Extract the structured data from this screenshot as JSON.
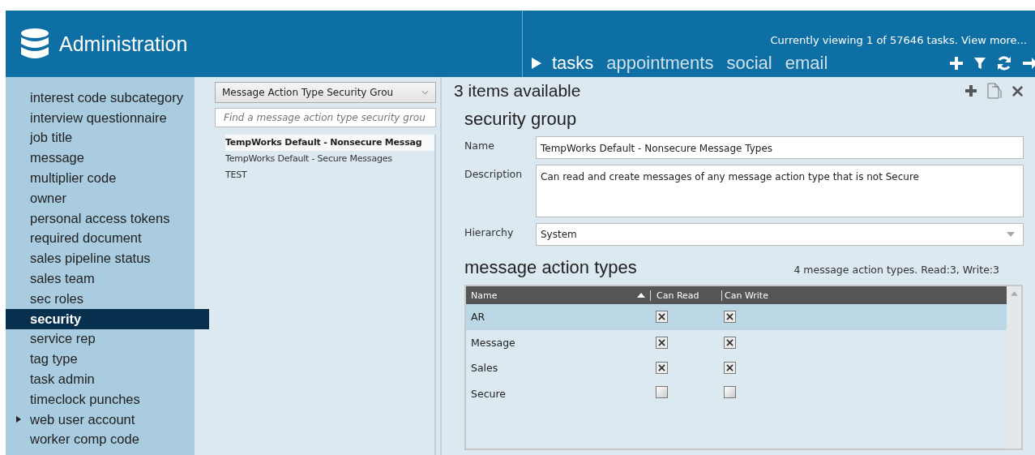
{
  "header": {
    "title": "Administration",
    "status": "Currently viewing 1 of 57646 tasks. View more...",
    "tabs": [
      {
        "label": "tasks",
        "selected": true
      },
      {
        "label": "appointments",
        "selected": false
      },
      {
        "label": "social",
        "selected": false
      },
      {
        "label": "email",
        "selected": false
      }
    ]
  },
  "sidebar": {
    "items": [
      {
        "label": "interest code subcategory",
        "selected": false,
        "has_children": false
      },
      {
        "label": "interview questionnaire",
        "selected": false,
        "has_children": false
      },
      {
        "label": "job title",
        "selected": false,
        "has_children": false
      },
      {
        "label": "message",
        "selected": false,
        "has_children": false
      },
      {
        "label": "multiplier code",
        "selected": false,
        "has_children": false
      },
      {
        "label": "owner",
        "selected": false,
        "has_children": false
      },
      {
        "label": "personal access tokens",
        "selected": false,
        "has_children": false
      },
      {
        "label": "required document",
        "selected": false,
        "has_children": false
      },
      {
        "label": "sales pipeline status",
        "selected": false,
        "has_children": false
      },
      {
        "label": "sales team",
        "selected": false,
        "has_children": false
      },
      {
        "label": "sec roles",
        "selected": false,
        "has_children": false
      },
      {
        "label": "security",
        "selected": true,
        "has_children": false
      },
      {
        "label": "service rep",
        "selected": false,
        "has_children": false
      },
      {
        "label": "tag type",
        "selected": false,
        "has_children": false
      },
      {
        "label": "task admin",
        "selected": false,
        "has_children": false
      },
      {
        "label": "timeclock punches",
        "selected": false,
        "has_children": false
      },
      {
        "label": "web user account",
        "selected": false,
        "has_children": true
      },
      {
        "label": "worker comp code",
        "selected": false,
        "has_children": false
      }
    ]
  },
  "list_panel": {
    "type_select": "Message Action Type Security Grou",
    "search": {
      "placeholder": "Find a message action type security grou"
    },
    "items": [
      {
        "label": "TempWorks Default - Nonsecure Messag",
        "selected": true
      },
      {
        "label": "TempWorks Default - Secure Messages",
        "selected": false
      },
      {
        "label": "TEST",
        "selected": false
      }
    ]
  },
  "detail": {
    "count": "3 items available",
    "section_title": "security group",
    "fields": [
      {
        "label": "Name",
        "value": "TempWorks Default - Nonsecure Message Types",
        "kind": "text"
      },
      {
        "label": "Description",
        "value": "Can read and create messages of any message action type that is not Secure",
        "kind": "textarea"
      },
      {
        "label": "Hierarchy",
        "value": "System",
        "kind": "select"
      }
    ],
    "types_title": "message action types",
    "types_summary": "4 message action types. Read:3, Write:3",
    "table": {
      "columns": [
        "Name",
        "Can Read",
        "Can Write"
      ],
      "rows": [
        {
          "name": "AR",
          "can_read": true,
          "can_write": true,
          "selected": true
        },
        {
          "name": "Message",
          "can_read": true,
          "can_write": true,
          "selected": false
        },
        {
          "name": "Sales",
          "can_read": true,
          "can_write": true,
          "selected": false
        },
        {
          "name": "Secure",
          "can_read": false,
          "can_write": false,
          "selected": false
        }
      ]
    }
  }
}
